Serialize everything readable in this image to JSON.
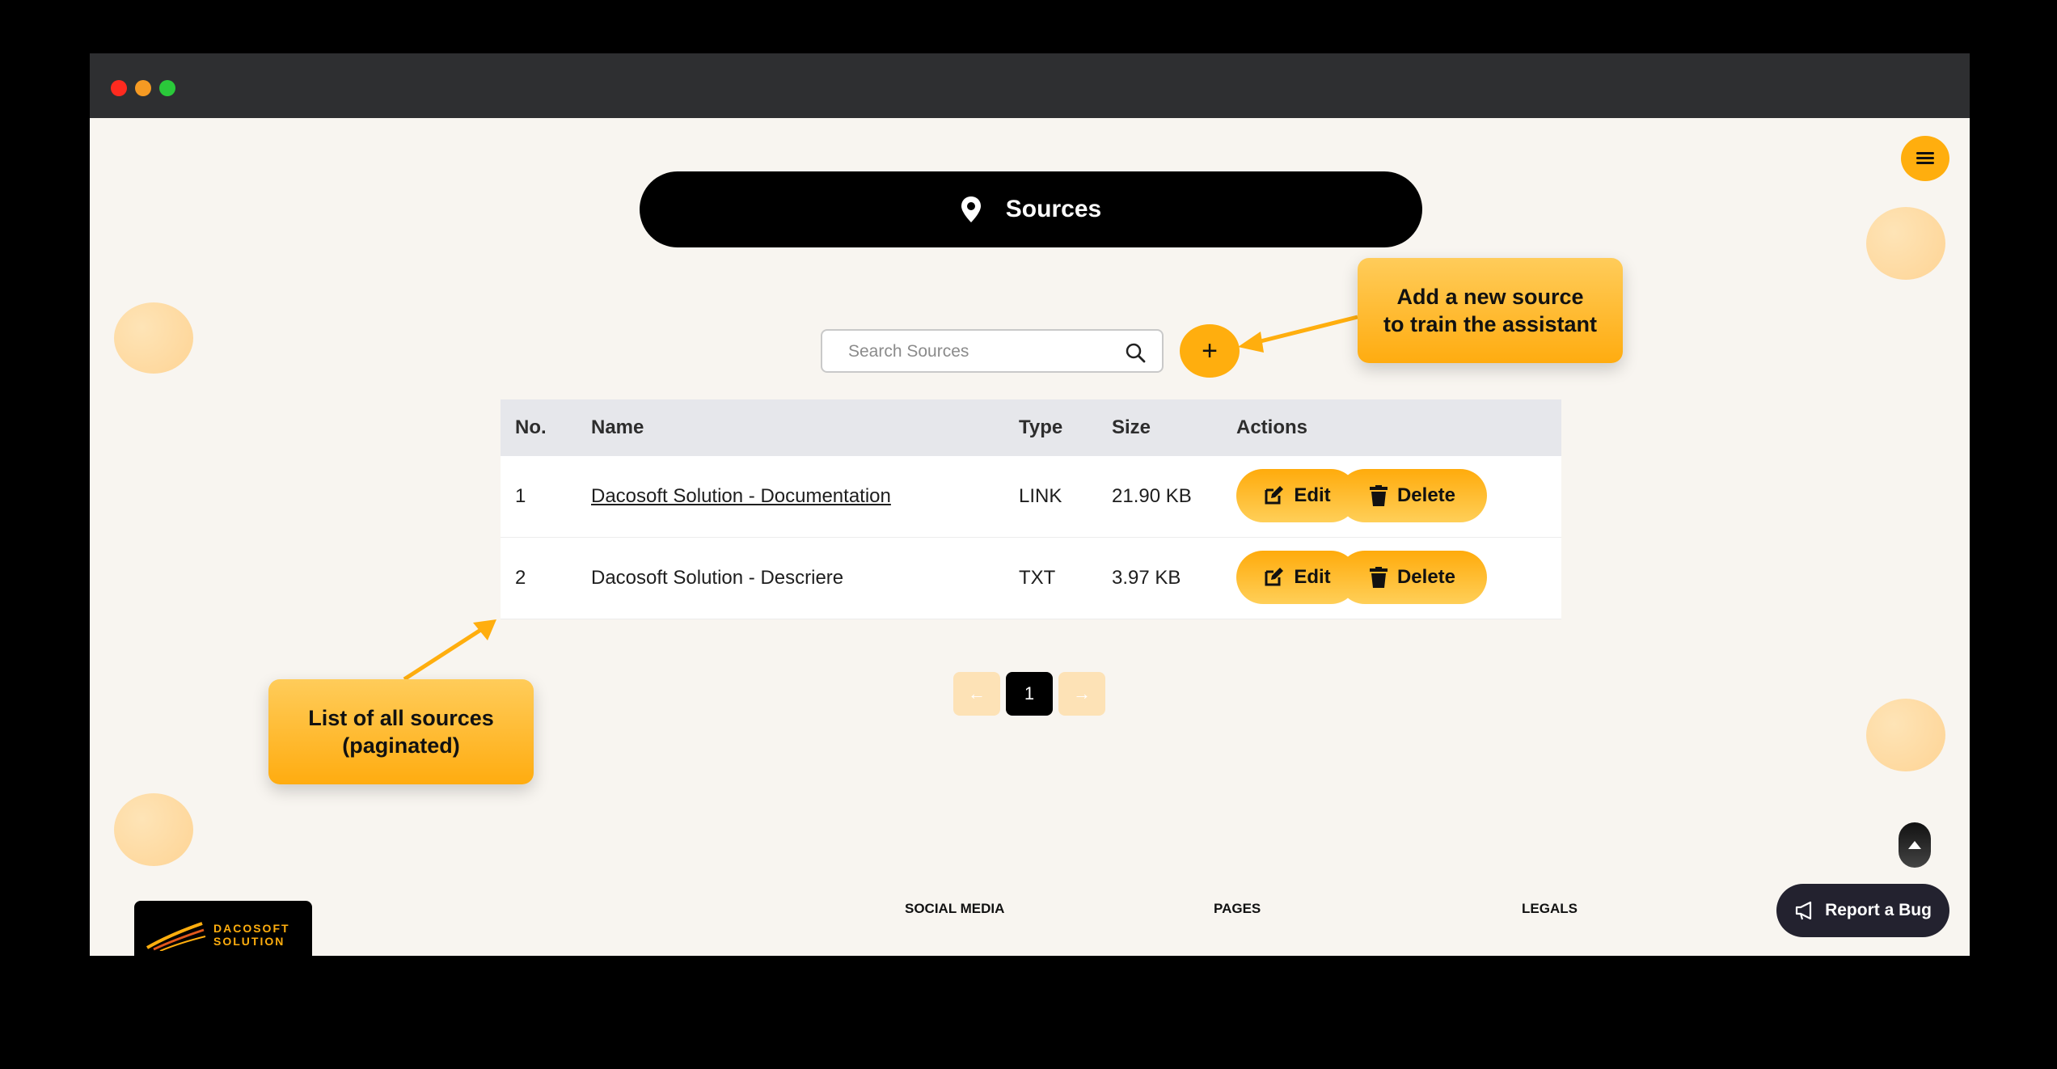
{
  "window": {
    "controls": [
      "close",
      "minimize",
      "maximize"
    ]
  },
  "header": {
    "title": "Sources",
    "icon": "location-pin-icon",
    "menu_icon": "hamburger-icon"
  },
  "search": {
    "placeholder": "Search Sources",
    "value": "",
    "icon": "search-icon"
  },
  "add_button": {
    "label": "+"
  },
  "table": {
    "headers": {
      "no": "No.",
      "name": "Name",
      "type": "Type",
      "size": "Size",
      "actions": "Actions"
    },
    "rows": [
      {
        "no": "1",
        "name": "Dacosoft Solution - Documentation",
        "type": "LINK",
        "size": "21.90 KB",
        "is_link": true
      },
      {
        "no": "2",
        "name": "Dacosoft Solution - Descriere",
        "type": "TXT",
        "size": "3.97 KB",
        "is_link": false
      }
    ],
    "edit_label": "Edit",
    "delete_label": "Delete"
  },
  "pagination": {
    "prev": "←",
    "current": "1",
    "next": "→"
  },
  "callouts": {
    "add": {
      "line1": "Add a new source",
      "line2": "to train the assistant"
    },
    "list": {
      "line1": "List of all sources",
      "line2": "(paginated)"
    }
  },
  "footer": {
    "logo_line1": "DACOSOFT",
    "logo_line2": "SOLUTION",
    "social": "SOCIAL MEDIA",
    "pages": "PAGES",
    "legals": "LEGALS"
  },
  "report_bug": {
    "label": "Report a Bug",
    "icon": "megaphone-icon"
  },
  "colors": {
    "accent": "#ffae0e",
    "dark": "#000000",
    "background": "#f8f5f0"
  }
}
